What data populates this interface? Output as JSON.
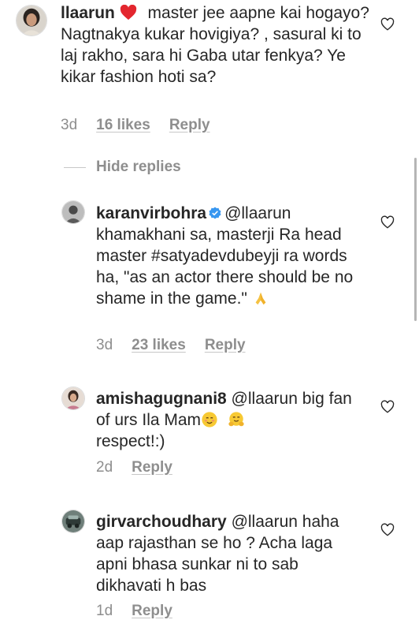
{
  "comments": [
    {
      "username": "llaarun",
      "text": "master jee aapne kai hogayo?  Nagtnakya kukar hovigiya? , sasural  ki to laj rakho, sara hi  Gaba utar fenkya? Ye kikar fashion hoti sa?",
      "age": "3d",
      "likes": "16 likes",
      "reply": "Reply"
    },
    {
      "username": "karanvirbohra",
      "mention": "@llaarun",
      "text": "khamakhani sa, masterji Ra head master #satyadevdubeyji ra words ha, \"as an actor there should be no shame in the game.\"",
      "age": "3d",
      "likes": "23 likes",
      "reply": "Reply"
    },
    {
      "username": "amishagugnani8",
      "mention": "@llaarun",
      "text": "big fan of urs Ila Mam",
      "text2": "respect!:)",
      "age": "2d",
      "reply": "Reply"
    },
    {
      "username": "girvarchoudhary",
      "mention": "@llaarun",
      "text": "haha aap rajasthan se ho ? Acha laga apni bhasa sunkar ni to sab dikhavati h bas",
      "age": "1d",
      "reply": "Reply"
    }
  ],
  "hide_replies": "Hide replies",
  "icons": [
    "red-heart-emoji",
    "verified-badge",
    "folded-hands-emoji",
    "smiling-face-emoji",
    "hugging-face-emoji",
    "heart-outline-icon"
  ]
}
